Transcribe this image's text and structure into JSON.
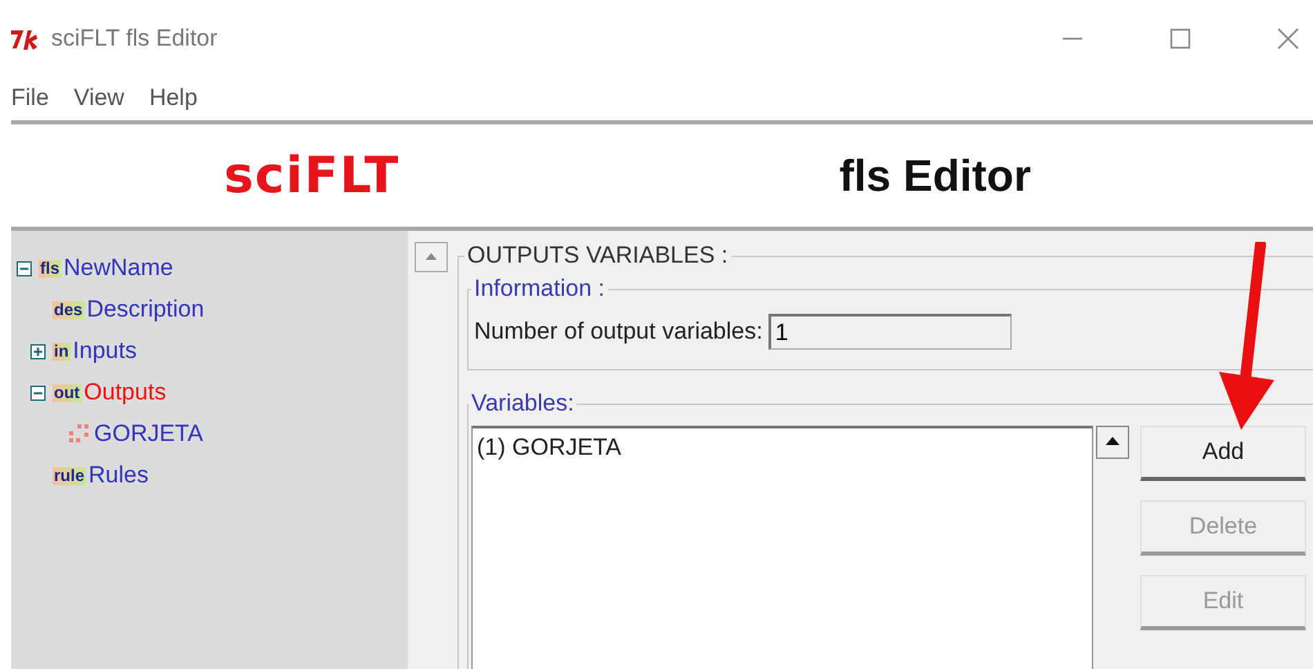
{
  "window": {
    "title": "sciFLT fls Editor"
  },
  "menu": [
    "File",
    "View",
    "Help"
  ],
  "banner": {
    "logo": "sciFLT",
    "title": "fls Editor"
  },
  "tree": [
    {
      "label": "NewName",
      "icon_label": "fls",
      "selected": false,
      "expanded": true,
      "children": [
        {
          "label": "Description",
          "icon_label": "des",
          "selected": false
        },
        {
          "label": "Inputs",
          "icon_label": "in",
          "selected": false,
          "expanded": false
        },
        {
          "label": "Outputs",
          "icon_label": "out",
          "selected": true,
          "expanded": true,
          "children": [
            {
              "label": "GORJETA",
              "selected": false
            }
          ]
        },
        {
          "label": "Rules",
          "icon_label": "rule",
          "selected": false
        }
      ]
    }
  ],
  "outputs": {
    "title": "OUTPUTS VARIABLES :",
    "information": {
      "title": "Information :",
      "label": "Number of output variables:",
      "value": "1"
    },
    "variables": {
      "title": "Variables:",
      "items": [
        "(1) GORJETA"
      ]
    },
    "buttons": [
      {
        "label": "Add",
        "disabled": false
      },
      {
        "label": "Delete",
        "disabled": true
      },
      {
        "label": "Edit",
        "disabled": true
      }
    ]
  }
}
